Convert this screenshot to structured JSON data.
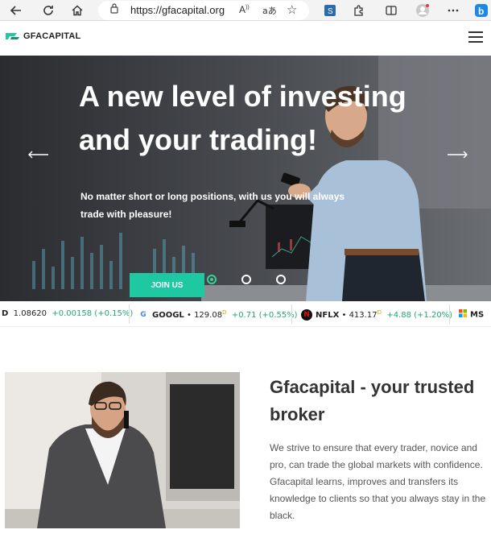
{
  "browser": {
    "url": "https://gfacapital.org",
    "read_aloud_label": "A",
    "translate_label": "aあ"
  },
  "header": {
    "logo_text": "GFACAPITAL"
  },
  "hero": {
    "title": "A new level of investing and your trading!",
    "subtitle": "No matter short or long positions, with us you will always trade with pleasure!",
    "cta_label": "JOIN US",
    "slides": 3,
    "active_slide": 1
  },
  "ticker": [
    {
      "symbol": "D",
      "price": "1.08620",
      "change": "+0.00158 (+0.15%)"
    },
    {
      "symbol": "GOOGL",
      "price": "129.08",
      "flag": "D",
      "change": "+0.71 (+0.55%)"
    },
    {
      "symbol": "NFLX",
      "price": "413.17",
      "flag": "D",
      "change": "+4.88 (+1.20%)"
    },
    {
      "symbol": "MS"
    }
  ],
  "about": {
    "title": "Gfacapital - your trusted broker",
    "text": "We strive to ensure that every trader, novice and pro, can trade the global markets with confidence. Gfacapital learns, improves and transfers its knowledge to clients so that you always stay in the black."
  },
  "colors": {
    "accent": "#1ec8a1",
    "positive": "#1ea96f"
  }
}
